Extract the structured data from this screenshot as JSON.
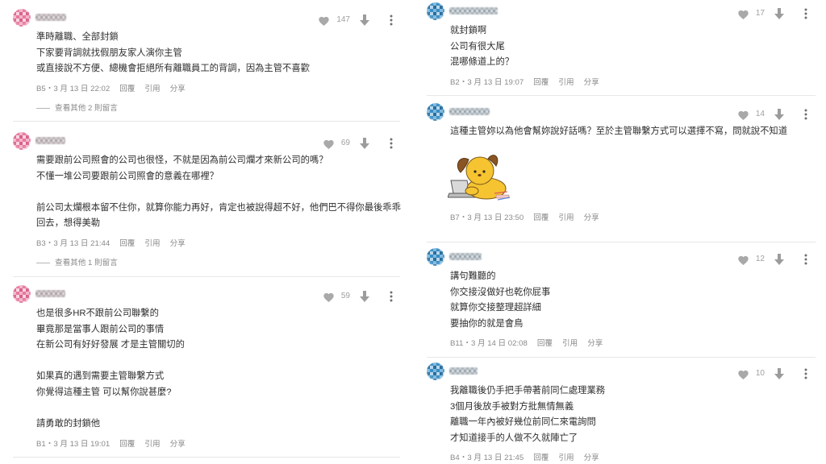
{
  "actions": {
    "reply": "回覆",
    "quote": "引用",
    "share": "分享"
  },
  "icons": {
    "like": "heart-icon",
    "dislike": "down-arrow-icon",
    "more": "more-vertical-icon"
  },
  "colors": {
    "text": "#2e2e2e",
    "meta": "#8a8a8a",
    "icon": "#a0a0a0",
    "divider": "#e7e7e7",
    "left_avatar": "#e7799d",
    "right_avatar": "#3a8cc2"
  },
  "left": {
    "comments": [
      {
        "likes": "147",
        "lines": [
          "準時離職、全部封鎖",
          "下家要背調就找假朋友家人演你主管",
          "或直接說不方便、總機會拒絕所有離職員工的背調，因為主管不喜歡"
        ],
        "meta": "B5・3 月 13 日 22:02",
        "more_replies": "查看其他 2 則留言"
      },
      {
        "likes": "69",
        "lines": [
          "需要跟前公司照會的公司也很怪，不就是因為前公司爛才來新公司的嗎？",
          "不懂一堆公司要跟前公司照會的意義在哪裡？",
          "前公司太爛根本留不住你，就算你能力再好，肯定也被說得超不好，他們巴不得你最後乖乖",
          "回去，想得美勒"
        ],
        "meta": "B3・3 月 13 日 21:44",
        "more_replies": "查看其他 1 則留言"
      },
      {
        "likes": "59",
        "lines": [
          "也是很多HR不跟前公司聯繫的",
          "畢竟那是當事人跟前公司的事情",
          "在新公司有好好發展 才是主管關切的",
          "如果真的遇到需要主管聯繫方式",
          "你覺得這種主管 可以幫你說甚麼?",
          "請勇敢的封鎖他"
        ],
        "meta": "B1・3 月 13 日 19:01"
      }
    ]
  },
  "right": {
    "comments": [
      {
        "likes": "17",
        "lines": [
          "就封鎖啊",
          "公司有很大尾",
          "混哪條道上的？"
        ],
        "meta": "B2・3 月 13 日 19:07"
      },
      {
        "likes": "14",
        "lines": [
          "這種主管妳以為他會幫妳說好話嗎？至於主管聯繫方式可以選擇不寫，問就說不知道"
        ],
        "sticker": "dog-laptop-sticker",
        "meta": "B7・3 月 13 日 23:50"
      },
      {
        "likes": "12",
        "lines": [
          "講句難聽的",
          "你交接沒做好也乾你屁事",
          "就算你交接整理超詳細",
          "要抽你的就是會鳥"
        ],
        "meta": "B11・3 月 14 日 02:08"
      },
      {
        "likes": "10",
        "lines": [
          "我離職後仍手把手帶著前同仁處理業務",
          "3個月後放手被對方批無情無義",
          "離職一年內被好幾位前同仁來電詢問",
          "才知道接手的人做不久就陣亡了"
        ],
        "meta": "B4・3 月 13 日 21:45"
      }
    ]
  }
}
